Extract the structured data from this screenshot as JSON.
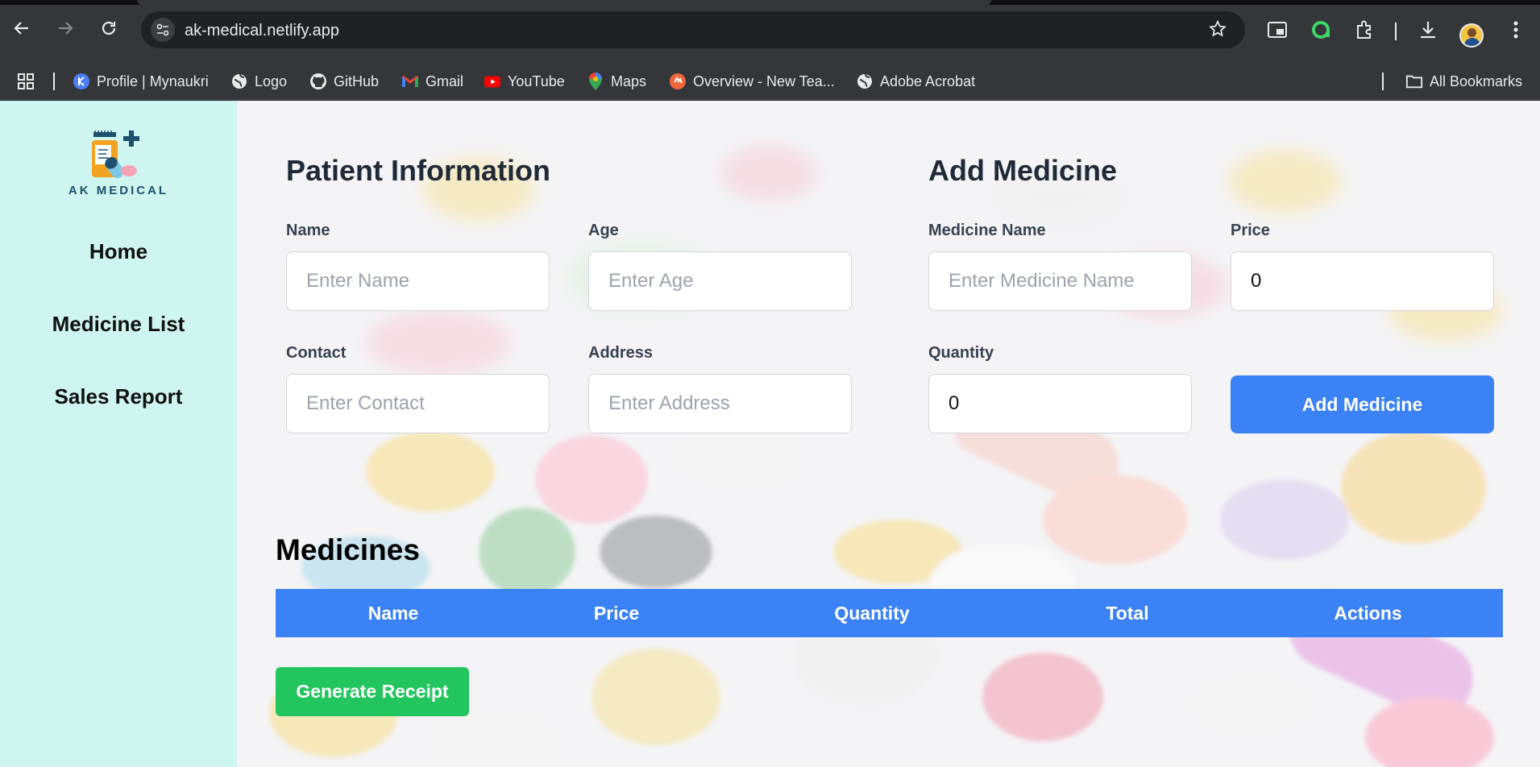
{
  "browser": {
    "url": "ak-medical.netlify.app",
    "bookmarks": [
      {
        "label": "Profile | Mynaukri",
        "icon": "naukri-icon"
      },
      {
        "label": "Logo",
        "icon": "globe-icon"
      },
      {
        "label": "GitHub",
        "icon": "github-icon"
      },
      {
        "label": "Gmail",
        "icon": "gmail-icon"
      },
      {
        "label": "YouTube",
        "icon": "youtube-icon"
      },
      {
        "label": "Maps",
        "icon": "maps-icon"
      },
      {
        "label": "Overview - New Tea...",
        "icon": "overview-icon"
      },
      {
        "label": "Adobe Acrobat",
        "icon": "globe-icon"
      }
    ],
    "all_bookmarks": "All Bookmarks"
  },
  "sidebar": {
    "brand": "AK MEDICAL",
    "links": [
      "Home",
      "Medicine List",
      "Sales Report"
    ]
  },
  "patient": {
    "title": "Patient Information",
    "name_label": "Name",
    "name_placeholder": "Enter Name",
    "age_label": "Age",
    "age_placeholder": "Enter Age",
    "contact_label": "Contact",
    "contact_placeholder": "Enter Contact",
    "address_label": "Address",
    "address_placeholder": "Enter Address"
  },
  "add_medicine": {
    "title": "Add Medicine",
    "medicine_name_label": "Medicine Name",
    "medicine_name_placeholder": "Enter Medicine Name",
    "price_label": "Price",
    "price_value": "0",
    "quantity_label": "Quantity",
    "quantity_value": "0",
    "button": "Add Medicine"
  },
  "medicines": {
    "title": "Medicines",
    "columns": [
      "Name",
      "Price",
      "Quantity",
      "Total",
      "Actions"
    ],
    "rows": []
  },
  "receipt_button": "Generate Receipt",
  "colors": {
    "sidebar": "#cff5f0",
    "primary": "#3b82f6",
    "success": "#22c55e"
  }
}
